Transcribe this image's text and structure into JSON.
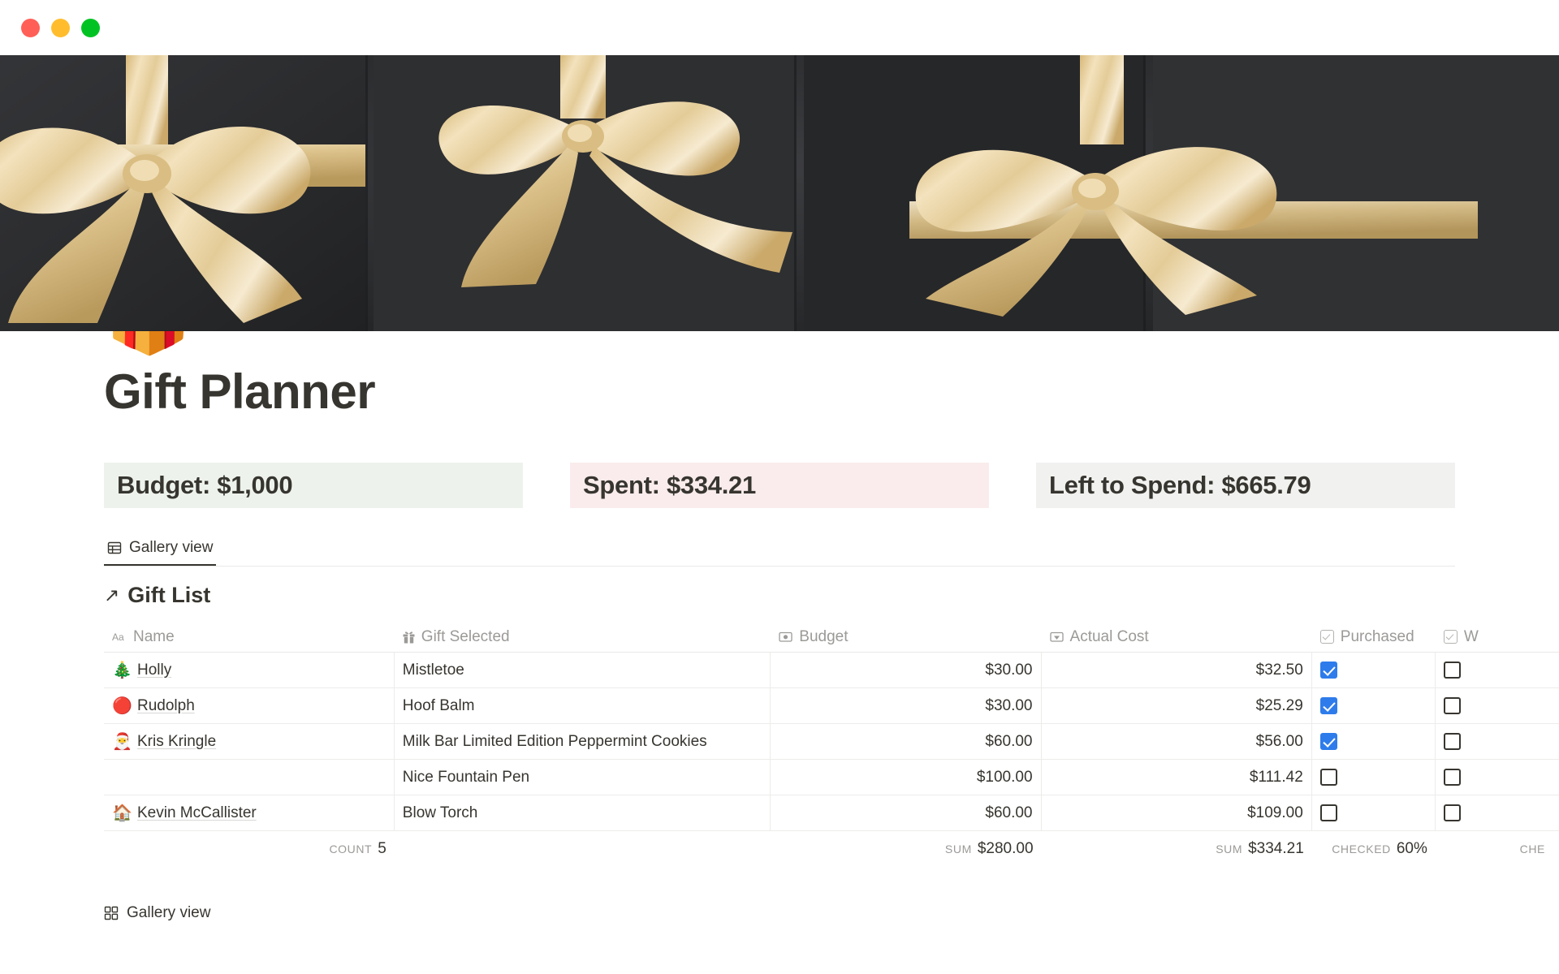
{
  "window": {
    "traffic_lights": [
      {
        "name": "close",
        "color": "#ff5f57"
      },
      {
        "name": "minimize",
        "color": "#ffbd2e"
      },
      {
        "name": "maximize",
        "color": "#00c323"
      }
    ]
  },
  "cover": {
    "description": "Dark charcoal gift boxes wrapped with gold satin ribbon bows",
    "background_color": "#2a2b2d",
    "ribbon_color": "#e8cf9c"
  },
  "page": {
    "icon": "🎁",
    "icon_name": "gift-emoji",
    "title": "Gift Planner"
  },
  "callouts": [
    {
      "label": "Budget: $1,000",
      "background": "#edf3ec",
      "name": "budget"
    },
    {
      "label": "Spent: $334.21",
      "background": "#faecec",
      "name": "spent"
    },
    {
      "label": "Left to Spend: $665.79",
      "background": "#f1f1ef",
      "name": "left-to-spend"
    }
  ],
  "view_tabs": [
    {
      "label": "Gallery view",
      "icon": "table-icon",
      "active": true
    }
  ],
  "database": {
    "title": "Gift List",
    "arrow": "↗",
    "columns": [
      {
        "key": "name",
        "label": "Name",
        "icon": "aa-text-icon"
      },
      {
        "key": "gift",
        "label": "Gift Selected",
        "icon": "gift-icon"
      },
      {
        "key": "budget",
        "label": "Budget",
        "icon": "currency-icon"
      },
      {
        "key": "actual",
        "label": "Actual Cost",
        "icon": "currency-icon"
      },
      {
        "key": "purchased",
        "label": "Purchased",
        "icon": "checkbox-icon"
      },
      {
        "key": "wrapped",
        "label": "W",
        "icon": "checkbox-icon"
      }
    ],
    "rows": [
      {
        "emoji": "🎄",
        "name": "Holly",
        "gift": "Mistletoe",
        "budget": "$30.00",
        "actual": "$32.50",
        "purchased": true,
        "wrapped": false
      },
      {
        "emoji": "🔴",
        "name": "Rudolph",
        "gift": "Hoof Balm",
        "budget": "$30.00",
        "actual": "$25.29",
        "purchased": true,
        "wrapped": false
      },
      {
        "emoji": "🎅",
        "name": "Kris Kringle",
        "gift": "Milk Bar Limited Edition Peppermint Cookies",
        "budget": "$60.00",
        "actual": "$56.00",
        "purchased": true,
        "wrapped": false
      },
      {
        "emoji": "",
        "name": "",
        "gift": "Nice Fountain Pen",
        "budget": "$100.00",
        "actual": "$111.42",
        "purchased": false,
        "wrapped": false
      },
      {
        "emoji": "🏠",
        "name": "Kevin McCallister",
        "gift": "Blow Torch",
        "budget": "$60.00",
        "actual": "$109.00",
        "purchased": false,
        "wrapped": false
      }
    ],
    "aggregates": {
      "name": {
        "label": "COUNT",
        "value": "5"
      },
      "gift": {
        "label": "",
        "value": ""
      },
      "budget": {
        "label": "SUM",
        "value": "$280.00"
      },
      "actual": {
        "label": "SUM",
        "value": "$334.21"
      },
      "purchased": {
        "label": "CHECKED",
        "value": "60%"
      },
      "wrapped": {
        "label": "CHE",
        "value": ""
      }
    }
  },
  "bottom_view": {
    "label": "Gallery view",
    "icon": "grid-icon"
  }
}
